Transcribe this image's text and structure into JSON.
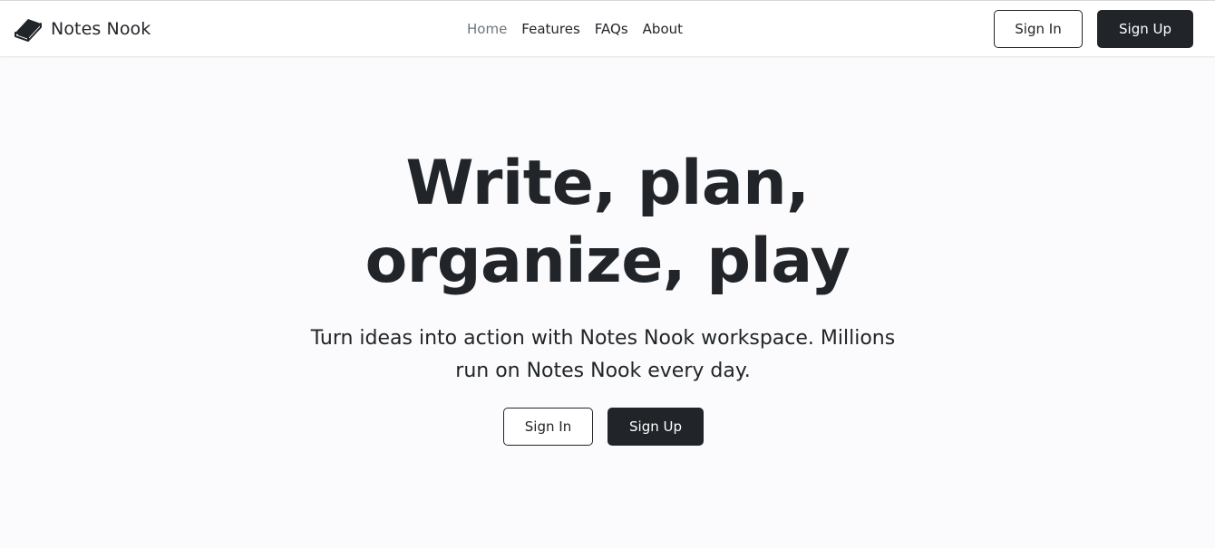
{
  "navbar": {
    "brand": {
      "icon": "book-icon",
      "name": "Notes Nook"
    },
    "links": [
      {
        "label": "Home",
        "active": true
      },
      {
        "label": "Features",
        "active": false
      },
      {
        "label": "FAQs",
        "active": false
      },
      {
        "label": "About",
        "active": false
      }
    ],
    "sign_in_label": "Sign In",
    "sign_up_label": "Sign Up"
  },
  "hero": {
    "title_line1": "Write, plan,",
    "title_line2": "organize, play",
    "subtitle": "Turn ideas into action with Notes Nook workspace. Millions run on Notes Nook every day.",
    "sign_in_label": "Sign In",
    "sign_up_label": "Sign Up"
  },
  "colors": {
    "text": "#212529",
    "muted": "#6c757d",
    "background": "#fbfbfd",
    "navbar": "#ffffff",
    "dark_button": "#212529"
  }
}
